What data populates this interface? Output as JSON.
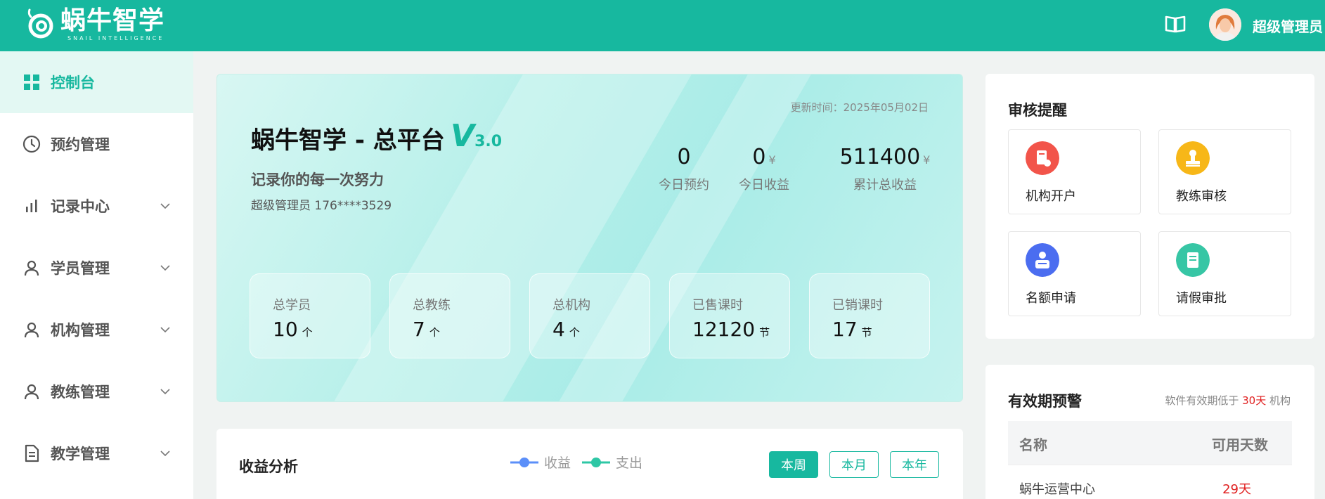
{
  "header": {
    "logo_main": "蜗牛智学",
    "logo_sub": "SNAIL INTELLIGENCE",
    "user_name": "超级管理员",
    "brand_color": "#17b89f"
  },
  "sidebar": {
    "items": [
      {
        "label": "控制台",
        "icon": "grid-icon",
        "active": true
      },
      {
        "label": "预约管理",
        "icon": "clock-icon"
      },
      {
        "label": "记录中心",
        "icon": "bar-chart-icon"
      },
      {
        "label": "学员管理",
        "icon": "user-icon"
      },
      {
        "label": "机构管理",
        "icon": "user-icon"
      },
      {
        "label": "教练管理",
        "icon": "user-icon"
      },
      {
        "label": "教学管理",
        "icon": "document-icon"
      }
    ]
  },
  "hero": {
    "update_time": "更新时间：2025年05月02日",
    "title": "蜗牛智学 - 总平台",
    "version_v": "V",
    "version_num": "3.0",
    "slogan": "记录你的每一次努力",
    "user_line": "超级管理员 176****3529",
    "kpis": [
      {
        "value": "0",
        "label": "今日预约"
      },
      {
        "value": "0",
        "unit": "¥",
        "label": "今日收益"
      },
      {
        "value": "511400",
        "unit": "¥",
        "label": "累计总收益"
      }
    ],
    "stats": [
      {
        "label": "总学员",
        "value": "10",
        "unit": "个"
      },
      {
        "label": "总教练",
        "value": "7",
        "unit": "个"
      },
      {
        "label": "总机构",
        "value": "4",
        "unit": "个"
      },
      {
        "label": "已售课时",
        "value": "12120",
        "unit": "节"
      },
      {
        "label": "已销课时",
        "value": "17",
        "unit": "节"
      }
    ]
  },
  "revenue": {
    "title": "收益分析",
    "legend": [
      {
        "name": "收益",
        "color": "#5b8ff9"
      },
      {
        "name": "支出",
        "color": "#2ec7a5"
      }
    ],
    "ranges": [
      "本周",
      "本月",
      "本年"
    ],
    "active_range": "本周"
  },
  "review": {
    "title": "审核提醒",
    "cards": [
      {
        "label": "机构开户",
        "icon": "account-icon",
        "color": "#f2544a"
      },
      {
        "label": "教练审核",
        "icon": "stamp-icon",
        "color": "#f7b718"
      },
      {
        "label": "名额申请",
        "icon": "person-card-icon",
        "color": "#4b6df0"
      },
      {
        "label": "请假审批",
        "icon": "note-icon",
        "color": "#37c6a5"
      }
    ]
  },
  "expiry": {
    "title": "有效期预警",
    "note_prefix": "软件有效期低于",
    "note_days": "30天",
    "note_suffix": "机构",
    "columns": [
      "名称",
      "可用天数"
    ],
    "rows": [
      {
        "name": "蜗牛运营中心",
        "days": "29天"
      }
    ]
  }
}
